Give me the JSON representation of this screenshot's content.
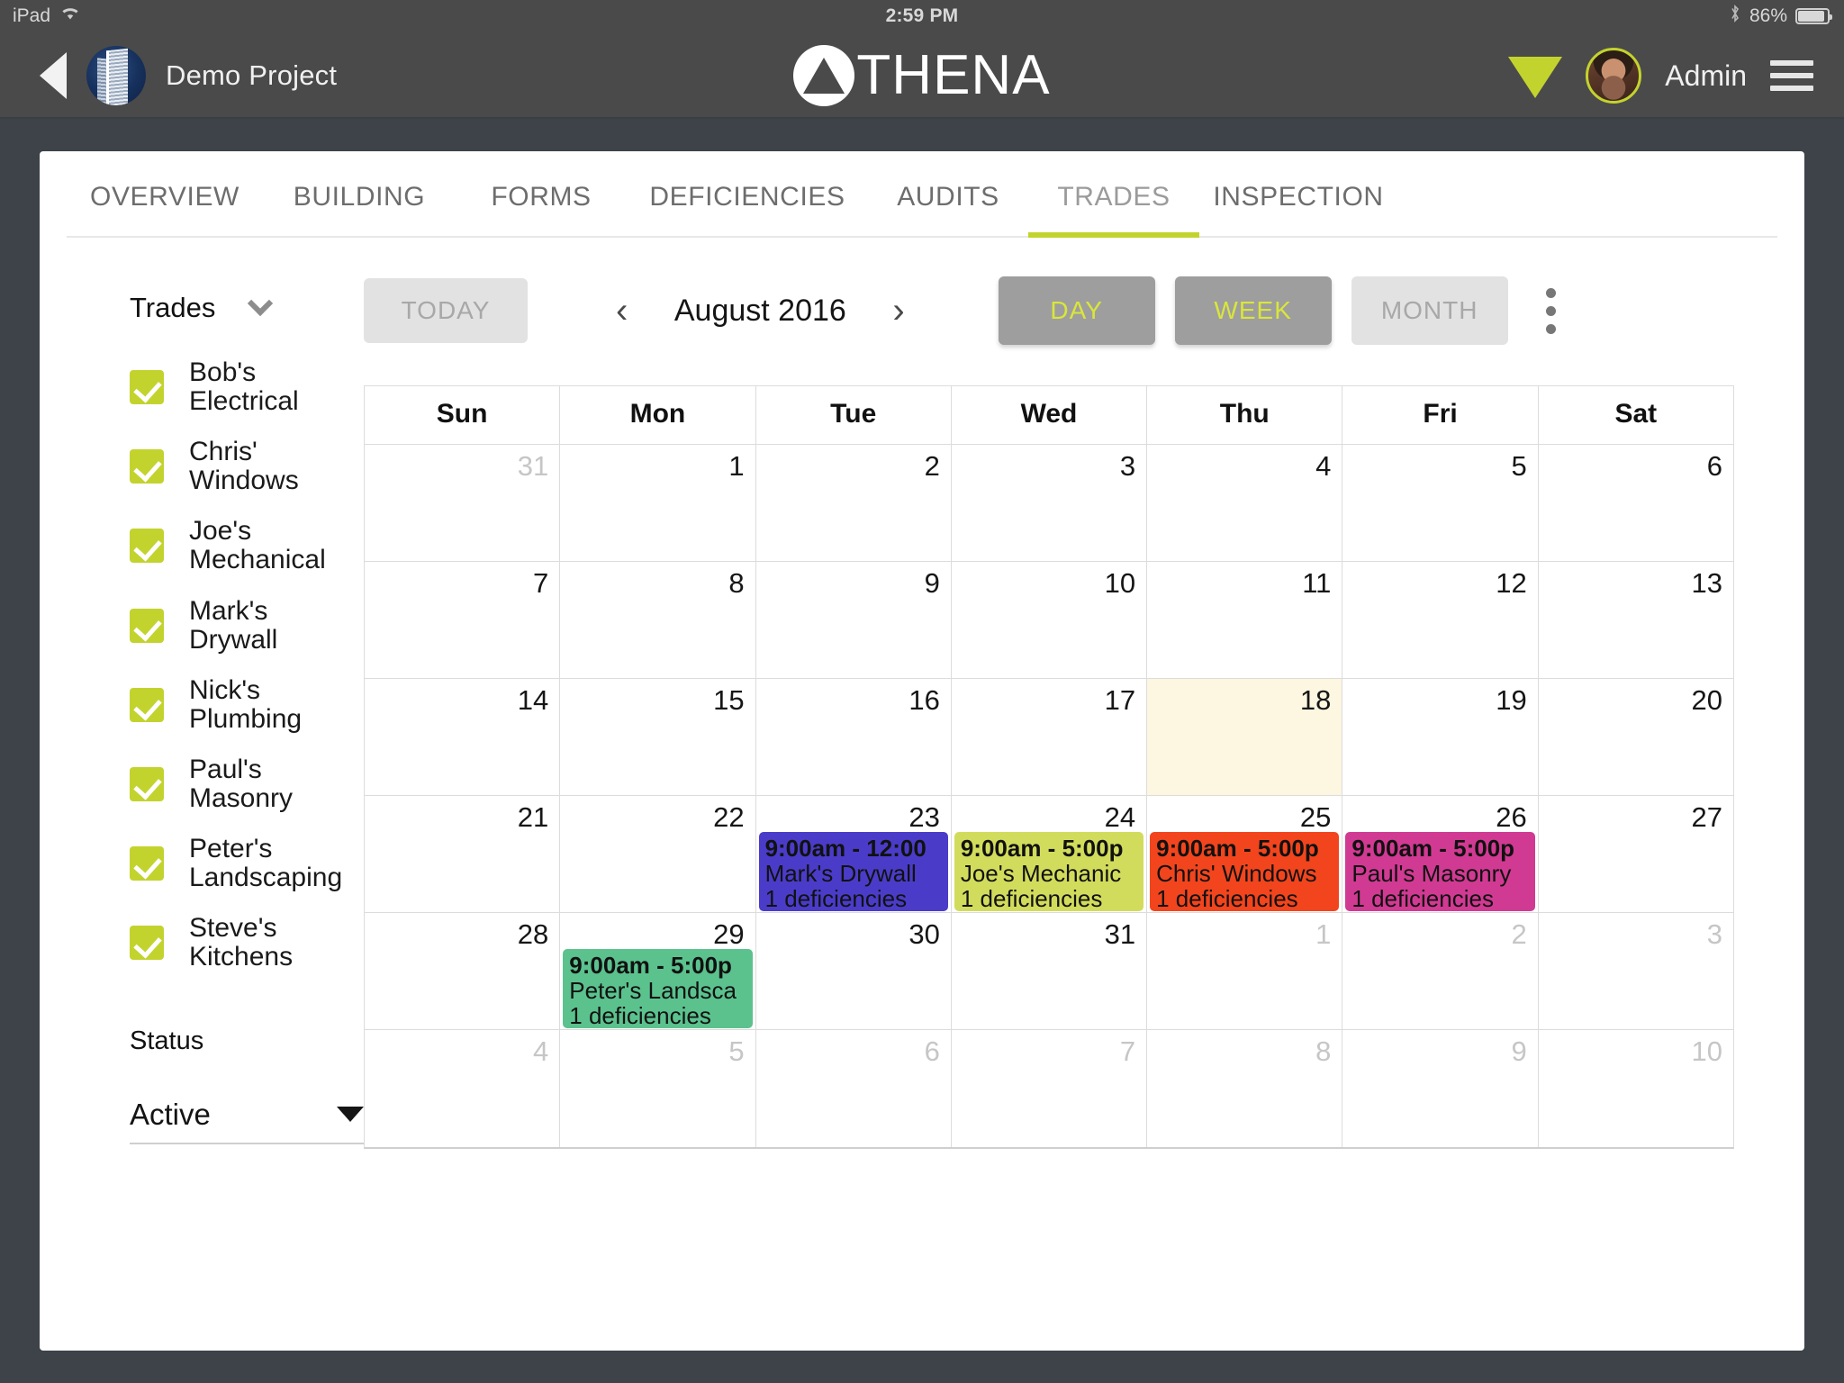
{
  "status_bar": {
    "device": "iPad",
    "wifi_icon": "wifi-icon",
    "time": "2:59 PM",
    "bluetooth_icon": "bluetooth-icon",
    "battery_percent": "86%"
  },
  "header": {
    "back_icon": "back-arrow-icon",
    "project_name": "Demo Project",
    "project_avatar_icon": "building-avatar",
    "logo_text": "THENA",
    "logo_icon": "athena-triangle-logo",
    "signal_icon": "signal-fan-icon",
    "user_avatar_icon": "user-avatar",
    "user_name": "Admin",
    "menu_icon": "hamburger-menu-icon",
    "accent_color": "#c3d32e"
  },
  "tabs": [
    {
      "label": "OVERVIEW",
      "active": false
    },
    {
      "label": "BUILDING",
      "active": false
    },
    {
      "label": "FORMS",
      "active": false
    },
    {
      "label": "DEFICIENCIES",
      "active": false
    },
    {
      "label": "AUDITS",
      "active": false
    },
    {
      "label": "TRADES",
      "active": true
    },
    {
      "label": "INSPECTION",
      "active": false
    }
  ],
  "sidebar": {
    "section_label": "Trades",
    "collapse_icon": "chevron-down-icon",
    "trades": [
      {
        "label": "Bob's Electrical",
        "checked": true
      },
      {
        "label": "Chris' Windows",
        "checked": true
      },
      {
        "label": "Joe's Mechanical",
        "checked": true
      },
      {
        "label": "Mark's Drywall",
        "checked": true
      },
      {
        "label": "Nick's Plumbing",
        "checked": true
      },
      {
        "label": "Paul's Masonry",
        "checked": true
      },
      {
        "label": "Peter's Landscaping",
        "checked": true
      },
      {
        "label": "Steve's Kitchens",
        "checked": true
      }
    ],
    "status_label": "Status",
    "status_value": "Active",
    "status_caret_icon": "caret-down-icon"
  },
  "toolbar": {
    "today_label": "TODAY",
    "prev_icon": "chevron-left-icon",
    "period_label": "August 2016",
    "next_icon": "chevron-right-icon",
    "views": [
      {
        "label": "DAY",
        "selected": true
      },
      {
        "label": "WEEK",
        "selected": true
      },
      {
        "label": "MONTH",
        "selected": false
      }
    ],
    "overflow_icon": "kebab-menu-icon"
  },
  "calendar": {
    "day_headers": [
      "Sun",
      "Mon",
      "Tue",
      "Wed",
      "Thu",
      "Fri",
      "Sat"
    ],
    "weeks": [
      [
        {
          "num": "31",
          "other": true
        },
        {
          "num": "1"
        },
        {
          "num": "2"
        },
        {
          "num": "3"
        },
        {
          "num": "4"
        },
        {
          "num": "5"
        },
        {
          "num": "6"
        }
      ],
      [
        {
          "num": "7"
        },
        {
          "num": "8"
        },
        {
          "num": "9"
        },
        {
          "num": "10"
        },
        {
          "num": "11"
        },
        {
          "num": "12"
        },
        {
          "num": "13"
        }
      ],
      [
        {
          "num": "14"
        },
        {
          "num": "15"
        },
        {
          "num": "16"
        },
        {
          "num": "17"
        },
        {
          "num": "18",
          "today": true
        },
        {
          "num": "19"
        },
        {
          "num": "20"
        }
      ],
      [
        {
          "num": "21"
        },
        {
          "num": "22"
        },
        {
          "num": "23",
          "event": {
            "time": "9:00am - 12:00",
            "name": "Mark's Drywall",
            "deficiencies": "1 deficiencies",
            "color": "#4a3cc8"
          }
        },
        {
          "num": "24",
          "event": {
            "time": "9:00am - 5:00p",
            "name": "Joe's Mechanic",
            "deficiencies": "1 deficiencies",
            "color": "#d2dc5c"
          }
        },
        {
          "num": "25",
          "event": {
            "time": "9:00am - 5:00p",
            "name": "Chris' Windows",
            "deficiencies": "1 deficiencies",
            "color": "#f2451d"
          }
        },
        {
          "num": "26",
          "event": {
            "time": "9:00am - 5:00p",
            "name": "Paul's Masonry",
            "deficiencies": "1 deficiencies",
            "color": "#d13a92"
          }
        },
        {
          "num": "27"
        }
      ],
      [
        {
          "num": "28"
        },
        {
          "num": "29",
          "event": {
            "time": "9:00am - 5:00p",
            "name": "Peter's Landsca",
            "deficiencies": "1 deficiencies",
            "color": "#5bc28e"
          }
        },
        {
          "num": "30"
        },
        {
          "num": "31"
        },
        {
          "num": "1",
          "other": true
        },
        {
          "num": "2",
          "other": true
        },
        {
          "num": "3",
          "other": true
        }
      ],
      [
        {
          "num": "4",
          "other": true
        },
        {
          "num": "5",
          "other": true
        },
        {
          "num": "6",
          "other": true
        },
        {
          "num": "7",
          "other": true
        },
        {
          "num": "8",
          "other": true
        },
        {
          "num": "9",
          "other": true
        },
        {
          "num": "10",
          "other": true
        }
      ]
    ]
  }
}
